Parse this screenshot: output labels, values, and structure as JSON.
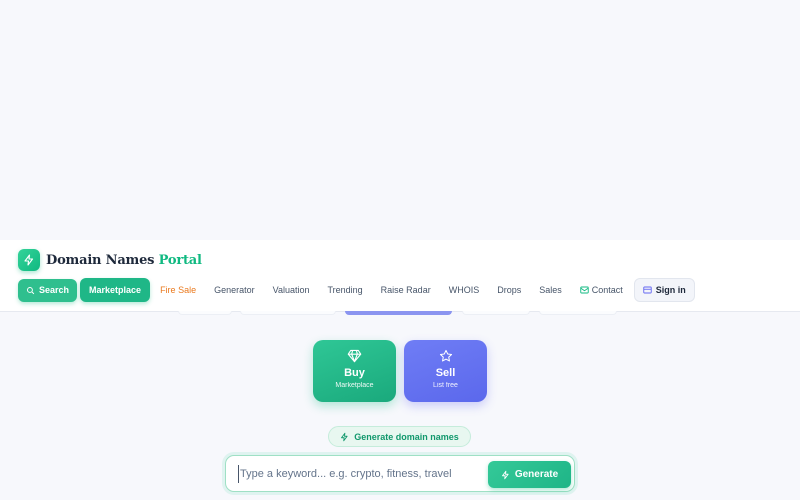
{
  "brand": {
    "name_main": "Domain Names",
    "name_accent": "Portal",
    "icon": "lightning-icon"
  },
  "nav": {
    "search_label": "Search",
    "marketplace_label": "Marketplace",
    "links": [
      "Fire Sale",
      "Generator",
      "Valuation",
      "Trending",
      "Raise Radar",
      "WHOIS",
      "Drops",
      "Sales"
    ],
    "contact_label": "Contact",
    "signin_label": "Sign in"
  },
  "cards": {
    "buy": {
      "title": "Buy",
      "subtitle": "Marketplace",
      "icon": "diamond-icon"
    },
    "sell": {
      "title": "Sell",
      "subtitle": "List free",
      "icon": "star-icon"
    }
  },
  "generator": {
    "pill_label": "Generate domain names",
    "placeholder": "Type a keyword... e.g. crypto, fitness, travel",
    "value": "",
    "button_label": "Generate"
  },
  "colors": {
    "primary": "#1fb787",
    "fire_sale": "#ea7a1f",
    "sell": "#5b68ec",
    "text_dark": "#1e293b"
  }
}
